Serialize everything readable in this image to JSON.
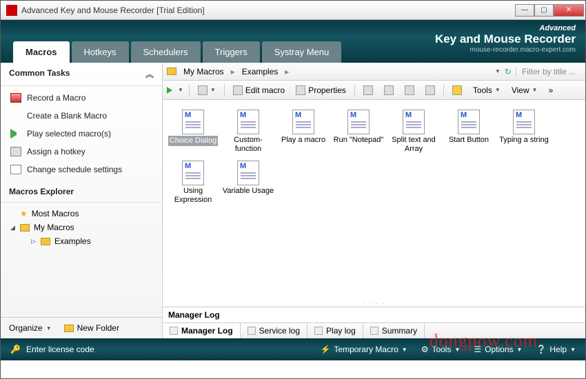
{
  "window": {
    "title": "Advanced Key and Mouse Recorder [Trial Edition]"
  },
  "brand": {
    "line1": "Advanced",
    "line2": "Key and Mouse Recorder",
    "line3": "mouse-recorder.macro-expert.com"
  },
  "tabs": [
    "Macros",
    "Hotkeys",
    "Schedulers",
    "Triggers",
    "Systray Menu"
  ],
  "sidebar": {
    "common_tasks_hdr": "Common Tasks",
    "tasks": [
      "Record a Macro",
      "Create a Blank Macro",
      "Play selected macro(s)",
      "Assign a hotkey",
      "Change schedule settings"
    ],
    "explorer_hdr": "Macros Explorer",
    "tree": {
      "most": "Most Macros",
      "my": "My Macros",
      "examples": "Examples"
    },
    "organize": "Organize",
    "new_folder": "New Folder"
  },
  "breadcrumb": {
    "root": "My Macros",
    "child": "Examples",
    "filter": "Filter by title ..."
  },
  "toolbar": {
    "edit": "Edit macro",
    "props": "Properties",
    "tools": "Tools",
    "view": "View"
  },
  "files": [
    "Choice Dialog",
    "Custom-function",
    "Play a macro",
    "Run \"Notepad\"",
    "Split text and Array",
    "Start Button",
    "Typing a string",
    "Using Expression",
    "Variable Usage"
  ],
  "log": {
    "hdr": "Manager Log",
    "tabs": [
      "Manager Log",
      "Service log",
      "Play log",
      "Summary"
    ]
  },
  "status": {
    "license": "Enter license code",
    "temp": "Temporary Macro",
    "tools": "Tools",
    "options": "Options",
    "help": "Help"
  },
  "watermark": "dongpow.com"
}
